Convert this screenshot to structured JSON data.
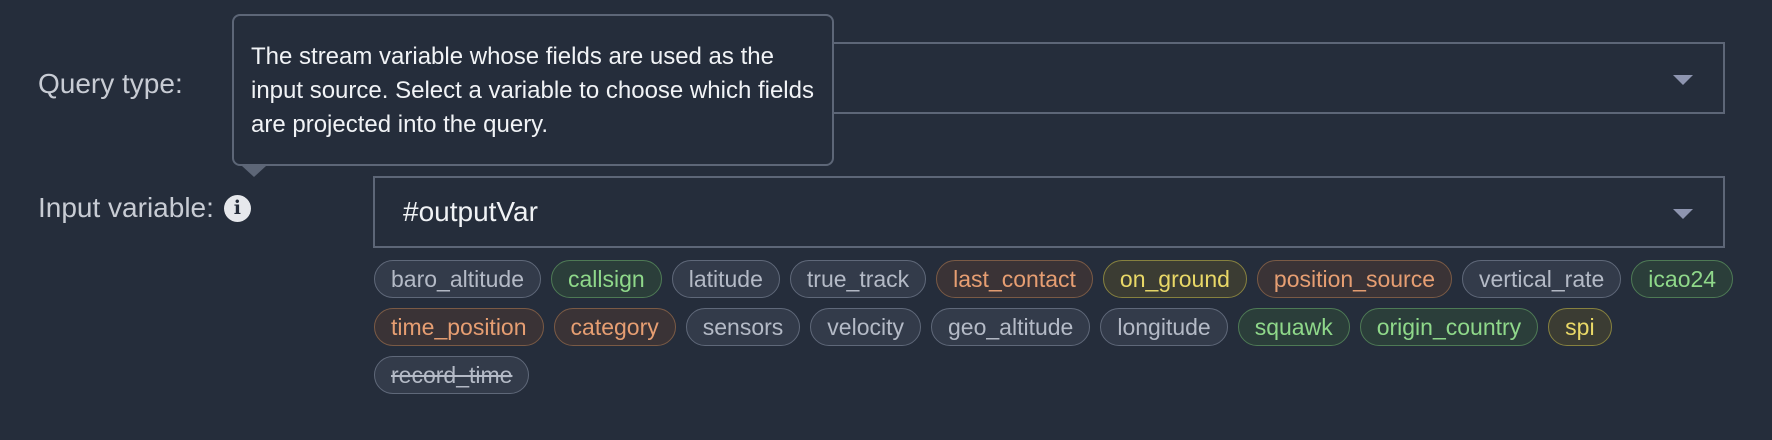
{
  "form": {
    "query_type_label": "Query type:",
    "query_type_value": "",
    "input_variable_label": "Input variable:",
    "input_variable_value": "#outputVar"
  },
  "tooltip": {
    "text": "The stream variable whose fields are used as the input source. Select a variable to choose which fields are projected into the query."
  },
  "icons": {
    "info": "info-icon",
    "dropdown": "chevron-down-icon"
  },
  "colors": {
    "background": "#252d3b",
    "border": "#5d6677",
    "chip_gray": "#b4bac6",
    "chip_green": "#8fd88a",
    "chip_orange": "#e69e72",
    "chip_yellow": "#e9d867"
  },
  "fields": [
    {
      "name": "baro_altitude",
      "color": "gray",
      "struck": false
    },
    {
      "name": "callsign",
      "color": "green",
      "struck": false
    },
    {
      "name": "latitude",
      "color": "gray",
      "struck": false
    },
    {
      "name": "true_track",
      "color": "gray",
      "struck": false
    },
    {
      "name": "last_contact",
      "color": "orange",
      "struck": false
    },
    {
      "name": "on_ground",
      "color": "yellow",
      "struck": false
    },
    {
      "name": "position_source",
      "color": "orange",
      "struck": false
    },
    {
      "name": "vertical_rate",
      "color": "gray",
      "struck": false
    },
    {
      "name": "icao24",
      "color": "green",
      "struck": false
    },
    {
      "name": "time_position",
      "color": "orange",
      "struck": false
    },
    {
      "name": "category",
      "color": "orange",
      "struck": false
    },
    {
      "name": "sensors",
      "color": "gray",
      "struck": false
    },
    {
      "name": "velocity",
      "color": "gray",
      "struck": false
    },
    {
      "name": "geo_altitude",
      "color": "gray",
      "struck": false
    },
    {
      "name": "longitude",
      "color": "gray",
      "struck": false
    },
    {
      "name": "squawk",
      "color": "green",
      "struck": false
    },
    {
      "name": "origin_country",
      "color": "green",
      "struck": false
    },
    {
      "name": "spi",
      "color": "yellow",
      "struck": false
    },
    {
      "name": "record_time",
      "color": "gray",
      "struck": true
    }
  ]
}
